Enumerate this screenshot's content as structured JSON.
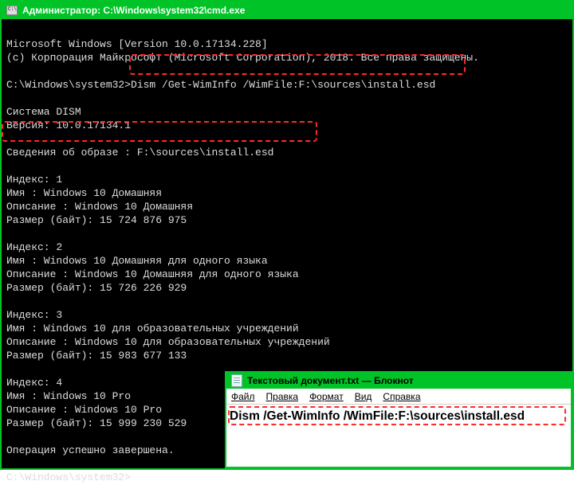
{
  "cmd": {
    "title": "Администратор: C:\\Windows\\system32\\cmd.exe",
    "lines": {
      "ver": "Microsoft Windows [Version 10.0.17134.228]",
      "copyright": "(c) Корпорация Майкрософт (Microsoft Corporation), 2018. Все права защищены.",
      "prompt1_path": "C:\\Windows\\system32>",
      "prompt1_cmd": "Dism /Get-WimInfo /WimFile:F:\\sources\\install.esd",
      "dism_sys": "Система DISM",
      "dism_ver": "Версия: 10.0.17134.1",
      "img_info_hdr": "Сведения об образе : F:\\sources\\install.esd",
      "idx1": "Индекс: 1",
      "name1": "Имя : Windows 10 Домашняя",
      "desc1": "Описание : Windows 10 Домашняя",
      "size1": "Размер (байт): 15 724 876 975",
      "idx2": "Индекс: 2",
      "name2": "Имя : Windows 10 Домашняя для одного языка",
      "desc2": "Описание : Windows 10 Домашняя для одного языка",
      "size2": "Размер (байт): 15 726 226 929",
      "idx3": "Индекс: 3",
      "name3": "Имя : Windows 10 для образовательных учреждений",
      "desc3": "Описание : Windows 10 для образовательных учреждений",
      "size3": "Размер (байт): 15 983 677 133",
      "idx4": "Индекс: 4",
      "name4": "Имя : Windows 10 Pro",
      "desc4": "Описание : Windows 10 Pro",
      "size4": "Размер (байт): 15 999 230 529",
      "done": "Операция успешно завершена.",
      "prompt2": "C:\\Windows\\system32>"
    }
  },
  "notepad": {
    "title": "Текстовый документ.txt — Блокнот",
    "menu": {
      "file": "Файл",
      "edit": "Правка",
      "format": "Формат",
      "view": "Вид",
      "help": "Справка"
    },
    "content": "Dism /Get-WimInfo /WimFile:F:\\sources\\install.esd"
  }
}
